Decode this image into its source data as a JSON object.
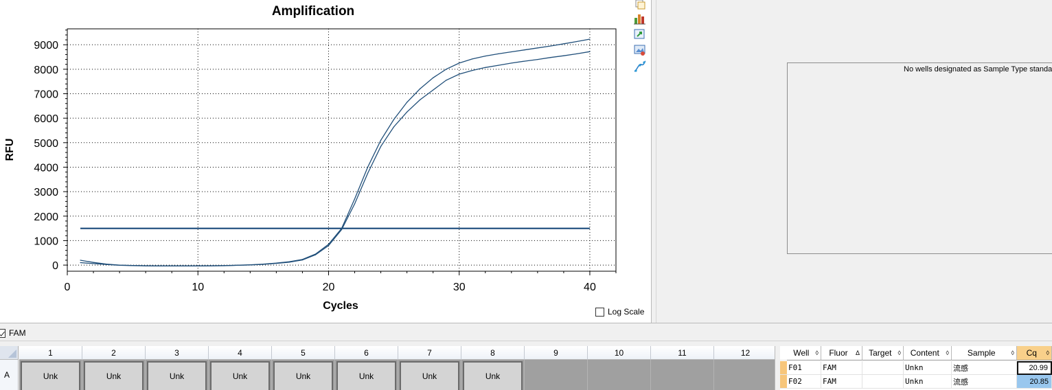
{
  "chart": {
    "title": "Amplification",
    "xlabel": "Cycles",
    "ylabel": "RFU",
    "log_scale_label": "Log Scale",
    "log_scale_checked": false
  },
  "chart_data": {
    "type": "line",
    "title": "Amplification",
    "xlabel": "Cycles",
    "ylabel": "RFU",
    "xlim": [
      0,
      42
    ],
    "ylim": [
      -250,
      9650
    ],
    "x_ticks": [
      0,
      10,
      20,
      30,
      40
    ],
    "y_ticks": [
      0,
      1000,
      2000,
      3000,
      4000,
      5000,
      6000,
      7000,
      8000,
      9000
    ],
    "grid": true,
    "line_color": "#1f4e79",
    "threshold": 1500,
    "series": [
      {
        "x": [
          1,
          2,
          3,
          4,
          5,
          6,
          7,
          8,
          9,
          10,
          11,
          12,
          13,
          14,
          15,
          16,
          17,
          18,
          19,
          20,
          21,
          22,
          23,
          24,
          25,
          26,
          27,
          28,
          29,
          30,
          31,
          32,
          33,
          34,
          35,
          36,
          37,
          38,
          39,
          40
        ],
        "values": [
          200,
          110,
          40,
          0,
          -15,
          -25,
          -30,
          -30,
          -30,
          -30,
          -25,
          -20,
          -5,
          10,
          40,
          80,
          140,
          230,
          450,
          850,
          1500,
          2700,
          4000,
          5100,
          5950,
          6650,
          7200,
          7650,
          8000,
          8250,
          8420,
          8540,
          8630,
          8710,
          8790,
          8870,
          8950,
          9040,
          9130,
          9230
        ]
      },
      {
        "x": [
          1,
          2,
          3,
          4,
          5,
          6,
          7,
          8,
          9,
          10,
          11,
          12,
          13,
          14,
          15,
          16,
          17,
          18,
          19,
          20,
          21,
          22,
          23,
          24,
          25,
          26,
          27,
          28,
          29,
          30,
          31,
          32,
          33,
          34,
          35,
          36,
          37,
          38,
          39,
          40
        ],
        "values": [
          100,
          60,
          25,
          -5,
          -20,
          -30,
          -35,
          -35,
          -35,
          -35,
          -30,
          -25,
          -10,
          5,
          30,
          70,
          120,
          210,
          420,
          800,
          1450,
          2500,
          3750,
          4850,
          5650,
          6250,
          6750,
          7150,
          7550,
          7800,
          7950,
          8070,
          8160,
          8250,
          8330,
          8400,
          8480,
          8550,
          8630,
          8720
        ]
      }
    ]
  },
  "tools": [
    "copy-icon",
    "bar-chart-icon",
    "export-icon",
    "image-icon",
    "curve-icon"
  ],
  "std_curve": {
    "message": "No wells designated as Sample Type standard"
  },
  "fluor": {
    "label": "FAM",
    "checked": true
  },
  "plate": {
    "columns": [
      "1",
      "2",
      "3",
      "4",
      "5",
      "6",
      "7",
      "8",
      "9",
      "10",
      "11",
      "12"
    ],
    "row_label": "A",
    "wells": [
      "Unk",
      "Unk",
      "Unk",
      "Unk",
      "Unk",
      "Unk",
      "Unk",
      "Unk",
      "",
      "",
      "",
      ""
    ]
  },
  "results": {
    "headers": [
      "Well",
      "Fluor",
      "Target",
      "Content",
      "Sample",
      "Cq"
    ],
    "sort_marks": [
      "◊",
      "Δ",
      "◊",
      "◊",
      "◊",
      "◊"
    ],
    "rows": [
      {
        "well": "F01",
        "fluor": "FAM",
        "target": "",
        "content": "Unkn",
        "sample": "流感",
        "cq": "20.99"
      },
      {
        "well": "F02",
        "fluor": "FAM",
        "target": "",
        "content": "Unkn",
        "sample": "流感",
        "cq": "20.85"
      }
    ]
  }
}
